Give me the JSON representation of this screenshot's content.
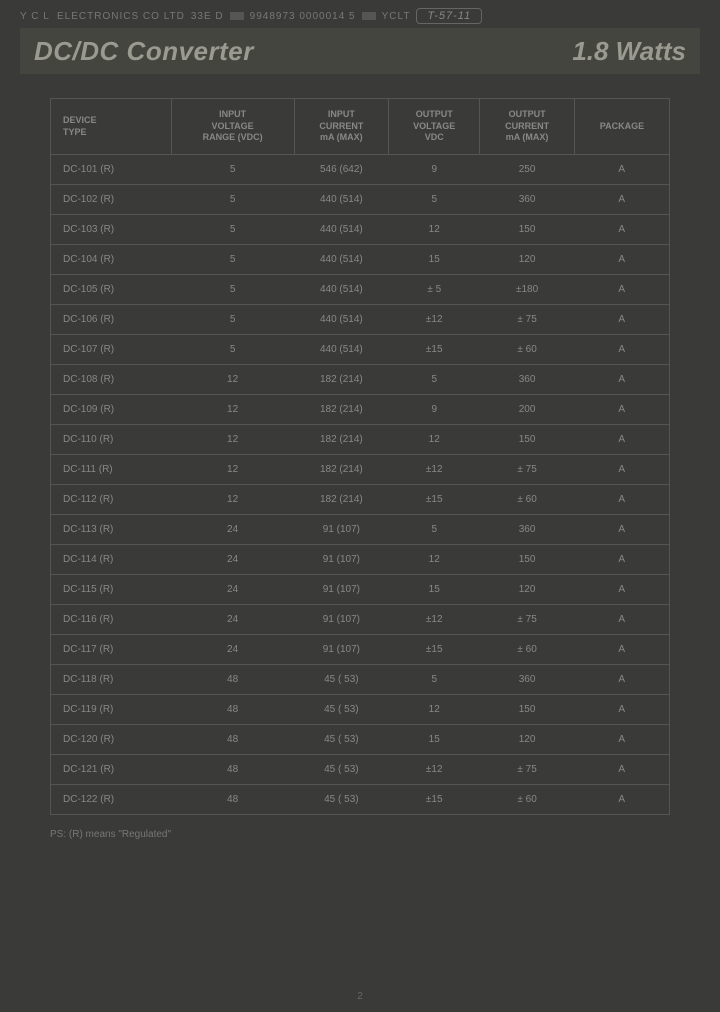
{
  "top": {
    "company": "Y C L  ELECTRONICS CO LTD",
    "code1": "33E D",
    "code2": "9948973 0000014 5",
    "code3": "YCLT",
    "ref": "T-57-11"
  },
  "titlebar": {
    "left": "DC/DC Converter",
    "right": "1.8 Watts"
  },
  "table": {
    "headers": [
      "DEVICE\nTYPE",
      "INPUT\nVOLTAGE\nRANGE (VDC)",
      "INPUT\nCURRENT\nmA (MAX)",
      "OUTPUT\nVOLTAGE\nVDC",
      "OUTPUT\nCURRENT\nmA (MAX)",
      "PACKAGE"
    ],
    "rows": [
      [
        "DC-101 (R)",
        "5",
        "546 (642)",
        "9",
        "250",
        "A"
      ],
      [
        "DC-102 (R)",
        "5",
        "440 (514)",
        "5",
        "360",
        "A"
      ],
      [
        "DC-103 (R)",
        "5",
        "440 (514)",
        "12",
        "150",
        "A"
      ],
      [
        "DC-104 (R)",
        "5",
        "440 (514)",
        "15",
        "120",
        "A"
      ],
      [
        "DC-105 (R)",
        "5",
        "440 (514)",
        "± 5",
        "±180",
        "A"
      ],
      [
        "DC-106 (R)",
        "5",
        "440 (514)",
        "±12",
        "± 75",
        "A"
      ],
      [
        "DC-107 (R)",
        "5",
        "440 (514)",
        "±15",
        "± 60",
        "A"
      ],
      [
        "DC-108 (R)",
        "12",
        "182 (214)",
        "5",
        "360",
        "A"
      ],
      [
        "DC-109 (R)",
        "12",
        "182 (214)",
        "9",
        "200",
        "A"
      ],
      [
        "DC-110 (R)",
        "12",
        "182 (214)",
        "12",
        "150",
        "A"
      ],
      [
        "DC-111 (R)",
        "12",
        "182 (214)",
        "±12",
        "± 75",
        "A"
      ],
      [
        "DC-112 (R)",
        "12",
        "182 (214)",
        "±15",
        "± 60",
        "A"
      ],
      [
        "DC-113 (R)",
        "24",
        "91 (107)",
        "5",
        "360",
        "A"
      ],
      [
        "DC-114 (R)",
        "24",
        "91 (107)",
        "12",
        "150",
        "A"
      ],
      [
        "DC-115 (R)",
        "24",
        "91 (107)",
        "15",
        "120",
        "A"
      ],
      [
        "DC-116 (R)",
        "24",
        "91 (107)",
        "±12",
        "± 75",
        "A"
      ],
      [
        "DC-117 (R)",
        "24",
        "91 (107)",
        "±15",
        "± 60",
        "A"
      ],
      [
        "DC-118 (R)",
        "48",
        "45 ( 53)",
        "5",
        "360",
        "A"
      ],
      [
        "DC-119 (R)",
        "48",
        "45 ( 53)",
        "12",
        "150",
        "A"
      ],
      [
        "DC-120 (R)",
        "48",
        "45 ( 53)",
        "15",
        "120",
        "A"
      ],
      [
        "DC-121 (R)",
        "48",
        "45 ( 53)",
        "±12",
        "± 75",
        "A"
      ],
      [
        "DC-122 (R)",
        "48",
        "45 ( 53)",
        "±15",
        "± 60",
        "A"
      ]
    ]
  },
  "footnote": "PS: (R) means \"Regulated\"",
  "pagenum": "2"
}
